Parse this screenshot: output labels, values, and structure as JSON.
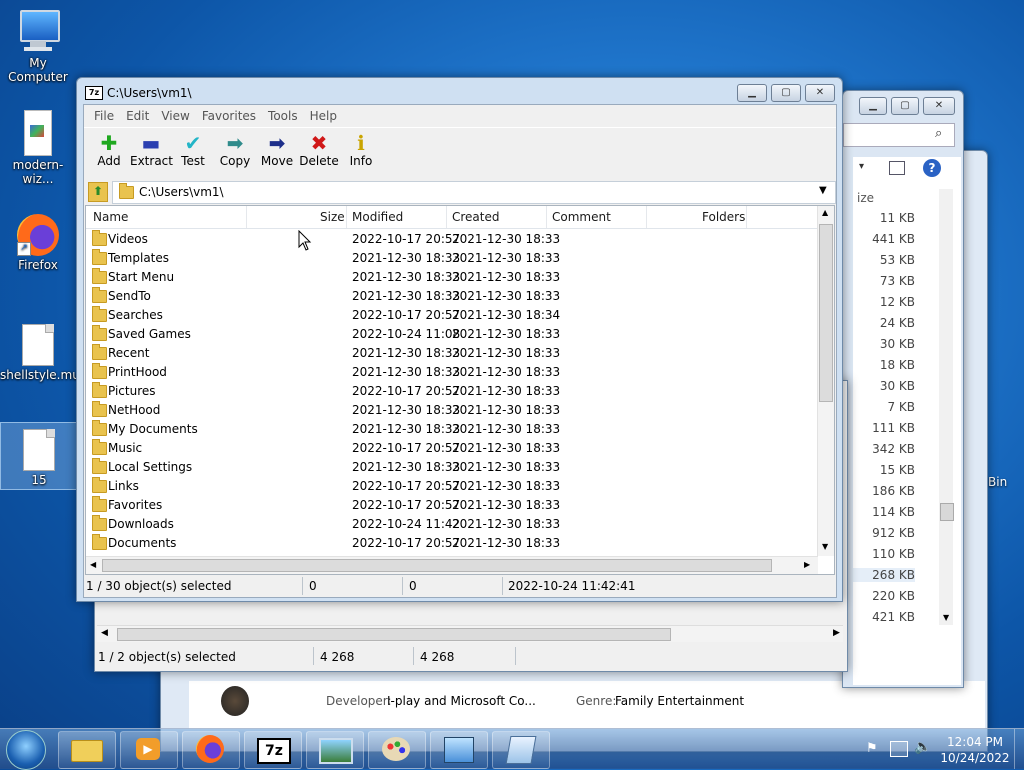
{
  "desktop": {
    "icons": [
      {
        "label": "My Computer"
      },
      {
        "label": "modern-wiz..."
      },
      {
        "label": "Firefox"
      },
      {
        "label": "shellstyle.mui"
      },
      {
        "label": "15"
      }
    ],
    "recycle_partial": "Bin"
  },
  "back_window": {
    "status": {
      "selected": "1 / 2 object(s) selected",
      "size1": "4 268",
      "size2": "4 268"
    },
    "sizes_header": "ize",
    "sizes": [
      "11 KB",
      "441 KB",
      "53 KB",
      "73 KB",
      "12 KB",
      "24 KB",
      "30 KB",
      "18 KB",
      "30 KB",
      "7 KB",
      "111 KB",
      "342 KB",
      "15 KB",
      "186 KB",
      "114 KB",
      "912 KB",
      "110 KB",
      "268 KB",
      "220 KB",
      "421 KB"
    ],
    "developer_label": "Developer:",
    "developer_value": "I-play and Microsoft Co...",
    "genre_label": "Genre:",
    "genre_value": "Family Entertainment"
  },
  "window": {
    "title": "C:\\Users\\vm1\\",
    "menu": [
      "File",
      "Edit",
      "View",
      "Favorites",
      "Tools",
      "Help"
    ],
    "toolbar": [
      {
        "label": "Add",
        "icon": "add-icon",
        "glyph": "✚",
        "color": "#1fa81f"
      },
      {
        "label": "Extract",
        "icon": "extract-icon",
        "glyph": "▬",
        "color": "#2b3fb0"
      },
      {
        "label": "Test",
        "icon": "test-icon",
        "glyph": "✔",
        "color": "#23b5c7"
      },
      {
        "label": "Copy",
        "icon": "copy-icon",
        "glyph": "➡",
        "color": "#2f8b8b"
      },
      {
        "label": "Move",
        "icon": "move-icon",
        "glyph": "➡",
        "color": "#1d2e8a"
      },
      {
        "label": "Delete",
        "icon": "delete-icon",
        "glyph": "✖",
        "color": "#d01818"
      },
      {
        "label": "Info",
        "icon": "info-icon",
        "glyph": "ℹ",
        "color": "#c9a400"
      }
    ],
    "address": "C:\\Users\\vm1\\",
    "columns": {
      "name": "Name",
      "size": "Size",
      "modified": "Modified",
      "created": "Created",
      "comment": "Comment",
      "folders": "Folders"
    },
    "rows": [
      {
        "name": "Videos",
        "modified": "2022-10-17 20:57",
        "created": "2021-12-30 18:33"
      },
      {
        "name": "Templates",
        "modified": "2021-12-30 18:33",
        "created": "2021-12-30 18:33"
      },
      {
        "name": "Start Menu",
        "modified": "2021-12-30 18:33",
        "created": "2021-12-30 18:33"
      },
      {
        "name": "SendTo",
        "modified": "2021-12-30 18:33",
        "created": "2021-12-30 18:33"
      },
      {
        "name": "Searches",
        "modified": "2022-10-17 20:57",
        "created": "2021-12-30 18:34"
      },
      {
        "name": "Saved Games",
        "modified": "2022-10-24 11:08",
        "created": "2021-12-30 18:33"
      },
      {
        "name": "Recent",
        "modified": "2021-12-30 18:33",
        "created": "2021-12-30 18:33"
      },
      {
        "name": "PrintHood",
        "modified": "2021-12-30 18:33",
        "created": "2021-12-30 18:33"
      },
      {
        "name": "Pictures",
        "modified": "2022-10-17 20:57",
        "created": "2021-12-30 18:33"
      },
      {
        "name": "NetHood",
        "modified": "2021-12-30 18:33",
        "created": "2021-12-30 18:33"
      },
      {
        "name": "My Documents",
        "modified": "2021-12-30 18:33",
        "created": "2021-12-30 18:33"
      },
      {
        "name": "Music",
        "modified": "2022-10-17 20:57",
        "created": "2021-12-30 18:33"
      },
      {
        "name": "Local Settings",
        "modified": "2021-12-30 18:33",
        "created": "2021-12-30 18:33"
      },
      {
        "name": "Links",
        "modified": "2022-10-17 20:57",
        "created": "2021-12-30 18:33"
      },
      {
        "name": "Favorites",
        "modified": "2022-10-17 20:57",
        "created": "2021-12-30 18:33"
      },
      {
        "name": "Downloads",
        "modified": "2022-10-24 11:42",
        "created": "2021-12-30 18:33"
      },
      {
        "name": "Documents",
        "modified": "2022-10-17 20:57",
        "created": "2021-12-30 18:33"
      }
    ],
    "status": {
      "selected": "1 / 30 object(s) selected",
      "size": "0",
      "packed": "0",
      "modified": "2022-10-24 11:42:41"
    }
  },
  "taskbar": {
    "clock_time": "12:04 PM",
    "clock_date": "10/24/2022",
    "apps": [
      "start-orb",
      "explorer",
      "media-player",
      "firefox",
      "7zip",
      "image-viewer",
      "paint",
      "control-panel",
      "notepad"
    ]
  }
}
